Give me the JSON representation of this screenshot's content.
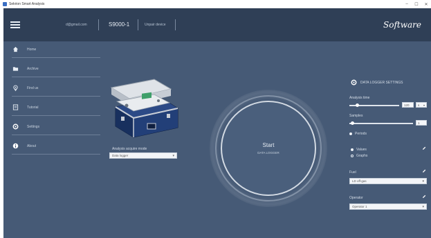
{
  "window": {
    "title": "Sekrion Smart Analysis",
    "controls": [
      "–",
      "☐",
      "✕"
    ]
  },
  "topbar": {
    "email": "d@gmail.com",
    "device": "S9000-1",
    "unpair": "Unpair device",
    "brand": "Software"
  },
  "sidebar": {
    "items": [
      {
        "label": "Home",
        "icon": "home-icon"
      },
      {
        "label": "Archive",
        "icon": "folder-icon"
      },
      {
        "label": "Find us",
        "icon": "location-pin-icon"
      },
      {
        "label": "Tutorial",
        "icon": "book-icon"
      },
      {
        "label": "Settings",
        "icon": "gear-icon"
      },
      {
        "label": "About",
        "icon": "info-icon"
      }
    ]
  },
  "main": {
    "mode_label": "Analysis acquire mode",
    "mode_value": "Data logger",
    "start_title": "Start",
    "start_subtitle": "DATA LOGGER"
  },
  "settings": {
    "title": "DATA LOGGER SETTINGS",
    "analysis_time_label": "Analysis time",
    "analysis_time_value": "120",
    "analysis_time_unit": "s",
    "analysis_time_fraction": 0.12,
    "samples_label": "Samples",
    "samples_value": "1",
    "samples_fraction": 0.02,
    "periods_label": "Periods",
    "display_options": [
      {
        "label": "Values",
        "selected": true
      },
      {
        "label": "Graphs",
        "selected": false
      }
    ],
    "fuel_label": "Fuel",
    "fuel_value": "LD off-gas",
    "operator_label": "Operator",
    "operator_value": "Operator 1"
  },
  "colors": {
    "app_bg": "#465a76",
    "topbar_bg": "#2f3f56",
    "text": "#d6dee8"
  }
}
